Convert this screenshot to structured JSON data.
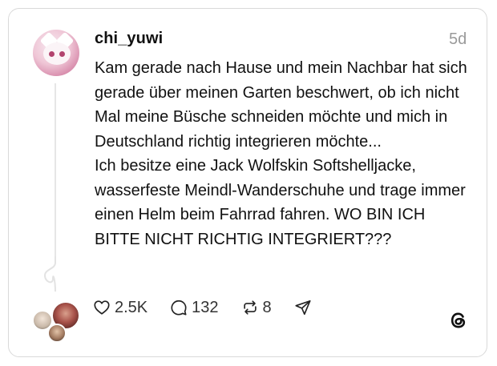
{
  "post": {
    "username": "chi_yuwi",
    "timestamp": "5d",
    "paragraphs": [
      "Kam gerade nach Hause und mein Nachbar hat sich gerade über meinen Garten beschwert, ob ich nicht Mal meine Büsche schneiden möchte und mich in Deutschland richtig integrieren möchte...",
      "Ich besitze eine Jack Wolfskin Softshelljacke, wasserfeste Meindl-Wanderschuhe und trage immer einen Helm beim Fahrrad fahren. WO BIN ICH BITTE NICHT RICHTIG INTEGRIERT???"
    ]
  },
  "actions": {
    "likes": "2.5K",
    "replies": "132",
    "reposts": "8"
  },
  "icons": {
    "like": "heart-icon",
    "reply": "speech-bubble-icon",
    "repost": "repost-icon",
    "share": "send-icon",
    "brand": "threads-logo-icon"
  },
  "colors": {
    "text": "#111111",
    "muted": "#9a9a9a",
    "border": "#d9d9d9",
    "avatar_pink": "#efc6d6"
  }
}
